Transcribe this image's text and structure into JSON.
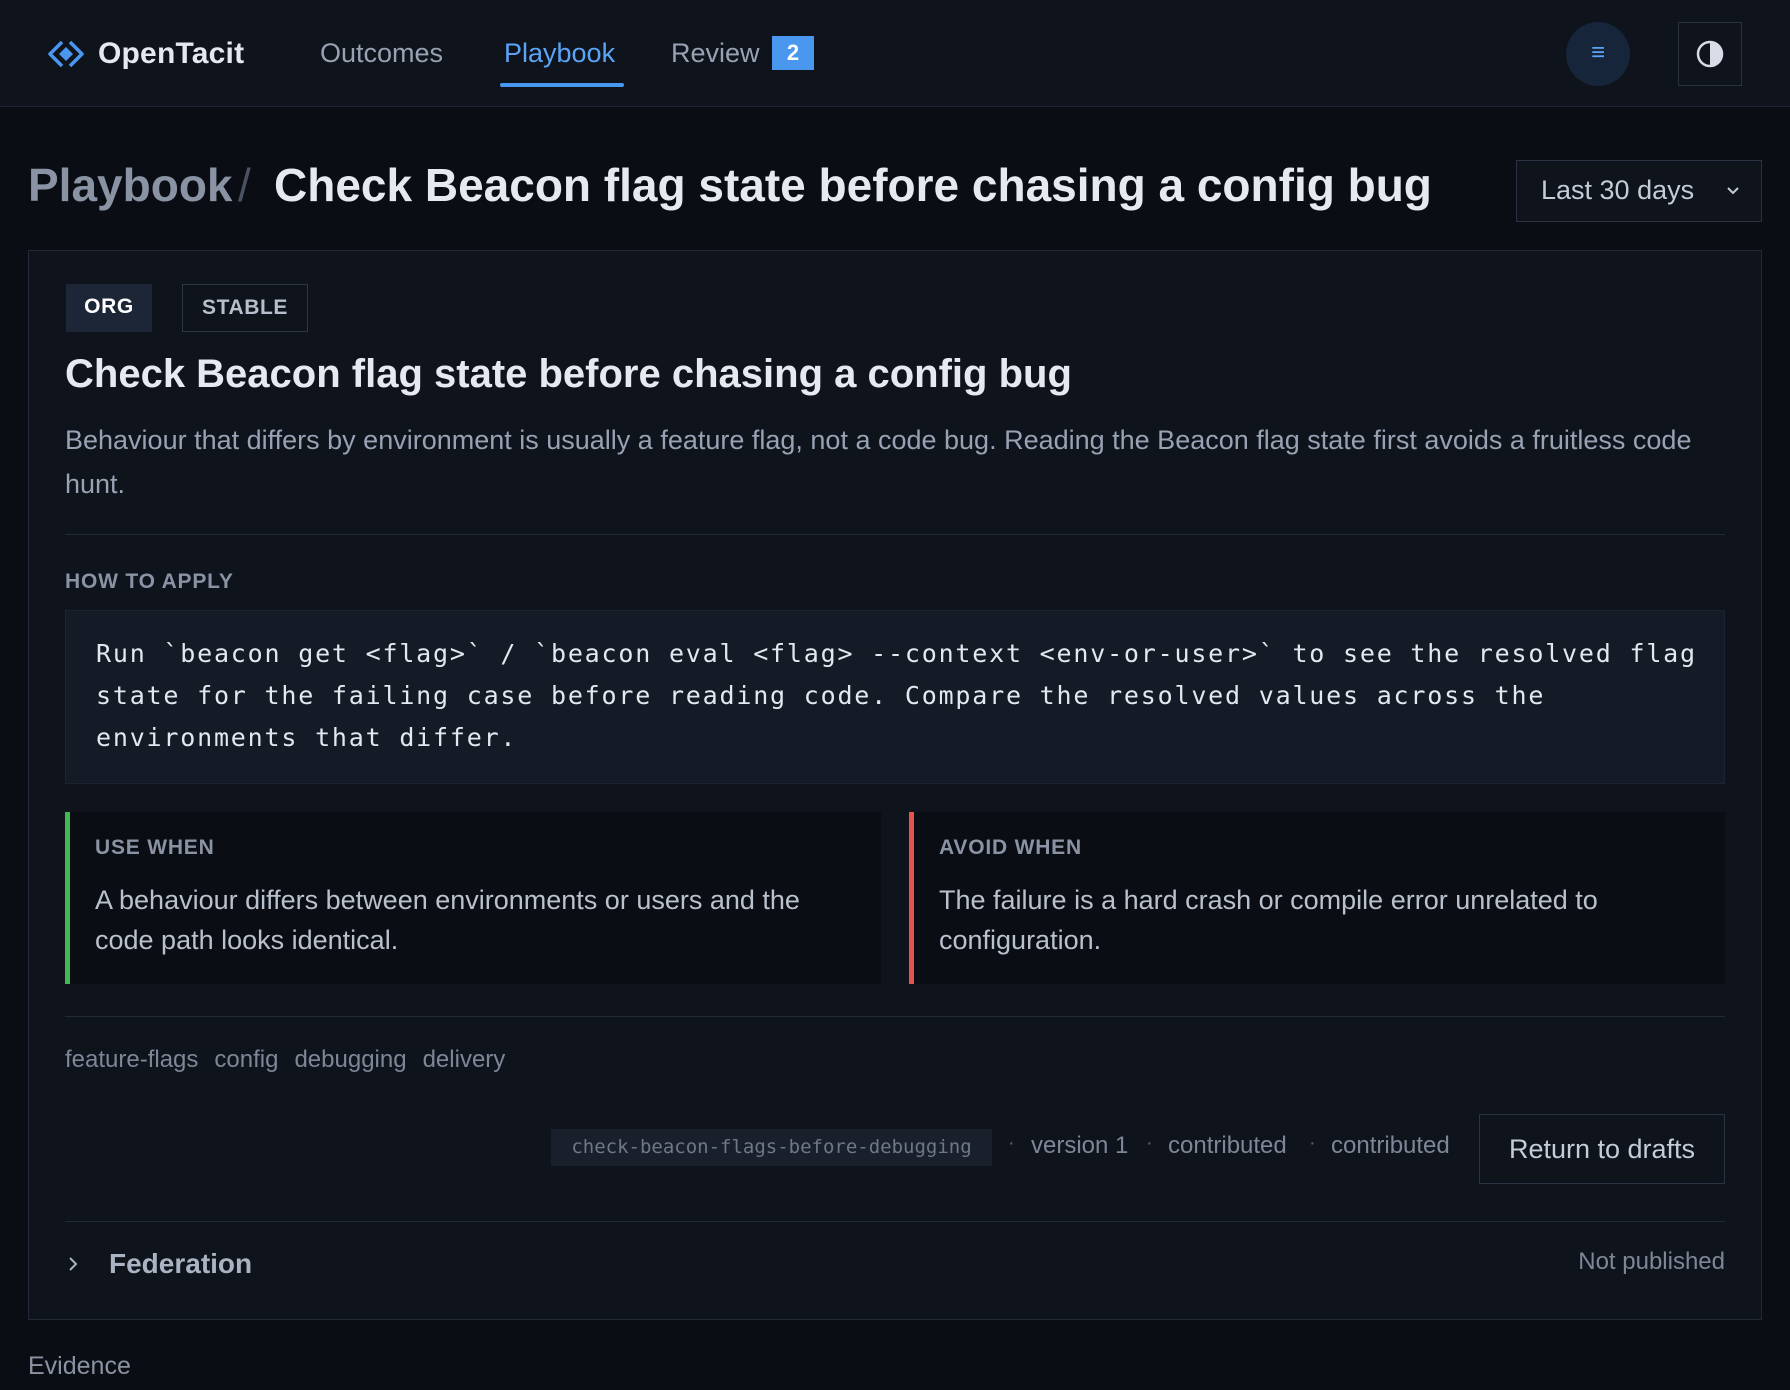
{
  "app": {
    "name": "OpenTacit"
  },
  "nav": {
    "outcomes": "Outcomes",
    "playbook": "Playbook",
    "review": "Review",
    "review_count": "2",
    "menu_glyph": "≡",
    "active": "Playbook"
  },
  "header": {
    "breadcrumb_parent": "Playbook",
    "separator": "/",
    "title": "Check Beacon flag state before chasing a config bug",
    "range": "Last 30 days"
  },
  "entry": {
    "scope_tag": "ORG",
    "status_tag": "STABLE",
    "title": "Check Beacon flag state before chasing a config bug",
    "description": "Behaviour that differs by environment is usually a feature flag, not a code bug. Reading the Beacon flag state first avoids a fruitless code hunt.",
    "how_to_apply_label": "HOW TO APPLY",
    "how_to_apply": "Run `beacon get <flag>` / `beacon eval <flag> --context <env-or-user>` to see the resolved flag state for the failing case before reading code. Compare the resolved values across the environments that differ.",
    "use_when_label": "USE WHEN",
    "use_when": "A behaviour differs between environments or users and the code path looks identical.",
    "avoid_when_label": "AVOID WHEN",
    "avoid_when": "The failure is a hard crash or compile error unrelated to configuration.",
    "topics": [
      "feature-flags",
      "config",
      "debugging",
      "delivery"
    ],
    "slug": "check-beacon-flags-before-debugging",
    "version": "version 1",
    "meta_a": "contributed",
    "meta_b": "contributed",
    "dot": "·",
    "return_button": "Return to drafts"
  },
  "federation": {
    "label": "Federation",
    "status": "Not published"
  },
  "evidence": {
    "label": "Evidence"
  },
  "colors": {
    "accent": "#4a97f0",
    "use_border": "#3fb950",
    "avoid_border": "#e5534b",
    "background": "#0a0d14"
  },
  "icons": {
    "brand": "diamond-logo-icon",
    "menu": "hamburger-icon",
    "theme": "contrast-icon",
    "range": "chevron-down-icon",
    "federation": "chevron-right-icon"
  }
}
